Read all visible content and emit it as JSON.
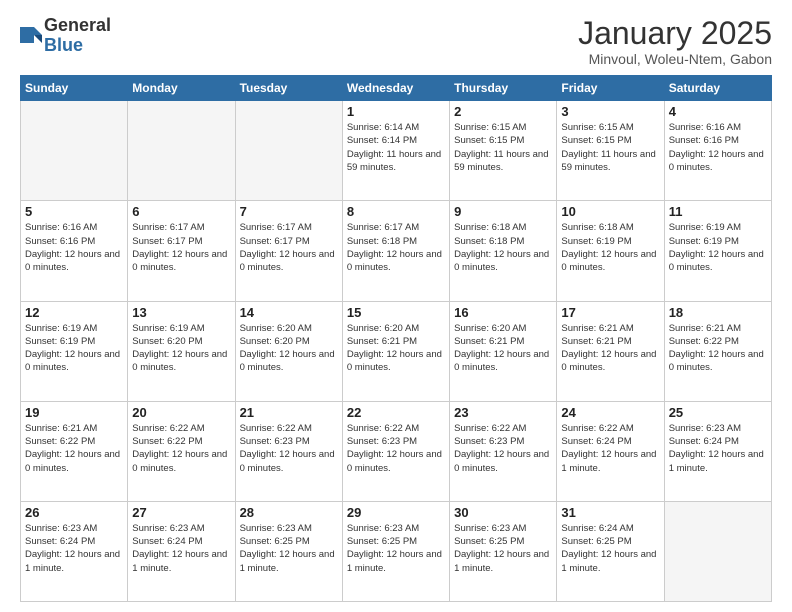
{
  "header": {
    "logo_general": "General",
    "logo_blue": "Blue",
    "month_title": "January 2025",
    "subtitle": "Minvoul, Woleu-Ntem, Gabon"
  },
  "days_of_week": [
    "Sunday",
    "Monday",
    "Tuesday",
    "Wednesday",
    "Thursday",
    "Friday",
    "Saturday"
  ],
  "weeks": [
    [
      {
        "day": "",
        "sunrise": "",
        "sunset": "",
        "daylight": ""
      },
      {
        "day": "",
        "sunrise": "",
        "sunset": "",
        "daylight": ""
      },
      {
        "day": "",
        "sunrise": "",
        "sunset": "",
        "daylight": ""
      },
      {
        "day": "1",
        "sunrise": "Sunrise: 6:14 AM",
        "sunset": "Sunset: 6:14 PM",
        "daylight": "Daylight: 11 hours and 59 minutes."
      },
      {
        "day": "2",
        "sunrise": "Sunrise: 6:15 AM",
        "sunset": "Sunset: 6:15 PM",
        "daylight": "Daylight: 11 hours and 59 minutes."
      },
      {
        "day": "3",
        "sunrise": "Sunrise: 6:15 AM",
        "sunset": "Sunset: 6:15 PM",
        "daylight": "Daylight: 11 hours and 59 minutes."
      },
      {
        "day": "4",
        "sunrise": "Sunrise: 6:16 AM",
        "sunset": "Sunset: 6:16 PM",
        "daylight": "Daylight: 12 hours and 0 minutes."
      }
    ],
    [
      {
        "day": "5",
        "sunrise": "Sunrise: 6:16 AM",
        "sunset": "Sunset: 6:16 PM",
        "daylight": "Daylight: 12 hours and 0 minutes."
      },
      {
        "day": "6",
        "sunrise": "Sunrise: 6:17 AM",
        "sunset": "Sunset: 6:17 PM",
        "daylight": "Daylight: 12 hours and 0 minutes."
      },
      {
        "day": "7",
        "sunrise": "Sunrise: 6:17 AM",
        "sunset": "Sunset: 6:17 PM",
        "daylight": "Daylight: 12 hours and 0 minutes."
      },
      {
        "day": "8",
        "sunrise": "Sunrise: 6:17 AM",
        "sunset": "Sunset: 6:18 PM",
        "daylight": "Daylight: 12 hours and 0 minutes."
      },
      {
        "day": "9",
        "sunrise": "Sunrise: 6:18 AM",
        "sunset": "Sunset: 6:18 PM",
        "daylight": "Daylight: 12 hours and 0 minutes."
      },
      {
        "day": "10",
        "sunrise": "Sunrise: 6:18 AM",
        "sunset": "Sunset: 6:19 PM",
        "daylight": "Daylight: 12 hours and 0 minutes."
      },
      {
        "day": "11",
        "sunrise": "Sunrise: 6:19 AM",
        "sunset": "Sunset: 6:19 PM",
        "daylight": "Daylight: 12 hours and 0 minutes."
      }
    ],
    [
      {
        "day": "12",
        "sunrise": "Sunrise: 6:19 AM",
        "sunset": "Sunset: 6:19 PM",
        "daylight": "Daylight: 12 hours and 0 minutes."
      },
      {
        "day": "13",
        "sunrise": "Sunrise: 6:19 AM",
        "sunset": "Sunset: 6:20 PM",
        "daylight": "Daylight: 12 hours and 0 minutes."
      },
      {
        "day": "14",
        "sunrise": "Sunrise: 6:20 AM",
        "sunset": "Sunset: 6:20 PM",
        "daylight": "Daylight: 12 hours and 0 minutes."
      },
      {
        "day": "15",
        "sunrise": "Sunrise: 6:20 AM",
        "sunset": "Sunset: 6:21 PM",
        "daylight": "Daylight: 12 hours and 0 minutes."
      },
      {
        "day": "16",
        "sunrise": "Sunrise: 6:20 AM",
        "sunset": "Sunset: 6:21 PM",
        "daylight": "Daylight: 12 hours and 0 minutes."
      },
      {
        "day": "17",
        "sunrise": "Sunrise: 6:21 AM",
        "sunset": "Sunset: 6:21 PM",
        "daylight": "Daylight: 12 hours and 0 minutes."
      },
      {
        "day": "18",
        "sunrise": "Sunrise: 6:21 AM",
        "sunset": "Sunset: 6:22 PM",
        "daylight": "Daylight: 12 hours and 0 minutes."
      }
    ],
    [
      {
        "day": "19",
        "sunrise": "Sunrise: 6:21 AM",
        "sunset": "Sunset: 6:22 PM",
        "daylight": "Daylight: 12 hours and 0 minutes."
      },
      {
        "day": "20",
        "sunrise": "Sunrise: 6:22 AM",
        "sunset": "Sunset: 6:22 PM",
        "daylight": "Daylight: 12 hours and 0 minutes."
      },
      {
        "day": "21",
        "sunrise": "Sunrise: 6:22 AM",
        "sunset": "Sunset: 6:23 PM",
        "daylight": "Daylight: 12 hours and 0 minutes."
      },
      {
        "day": "22",
        "sunrise": "Sunrise: 6:22 AM",
        "sunset": "Sunset: 6:23 PM",
        "daylight": "Daylight: 12 hours and 0 minutes."
      },
      {
        "day": "23",
        "sunrise": "Sunrise: 6:22 AM",
        "sunset": "Sunset: 6:23 PM",
        "daylight": "Daylight: 12 hours and 0 minutes."
      },
      {
        "day": "24",
        "sunrise": "Sunrise: 6:22 AM",
        "sunset": "Sunset: 6:24 PM",
        "daylight": "Daylight: 12 hours and 1 minute."
      },
      {
        "day": "25",
        "sunrise": "Sunrise: 6:23 AM",
        "sunset": "Sunset: 6:24 PM",
        "daylight": "Daylight: 12 hours and 1 minute."
      }
    ],
    [
      {
        "day": "26",
        "sunrise": "Sunrise: 6:23 AM",
        "sunset": "Sunset: 6:24 PM",
        "daylight": "Daylight: 12 hours and 1 minute."
      },
      {
        "day": "27",
        "sunrise": "Sunrise: 6:23 AM",
        "sunset": "Sunset: 6:24 PM",
        "daylight": "Daylight: 12 hours and 1 minute."
      },
      {
        "day": "28",
        "sunrise": "Sunrise: 6:23 AM",
        "sunset": "Sunset: 6:25 PM",
        "daylight": "Daylight: 12 hours and 1 minute."
      },
      {
        "day": "29",
        "sunrise": "Sunrise: 6:23 AM",
        "sunset": "Sunset: 6:25 PM",
        "daylight": "Daylight: 12 hours and 1 minute."
      },
      {
        "day": "30",
        "sunrise": "Sunrise: 6:23 AM",
        "sunset": "Sunset: 6:25 PM",
        "daylight": "Daylight: 12 hours and 1 minute."
      },
      {
        "day": "31",
        "sunrise": "Sunrise: 6:24 AM",
        "sunset": "Sunset: 6:25 PM",
        "daylight": "Daylight: 12 hours and 1 minute."
      },
      {
        "day": "",
        "sunrise": "",
        "sunset": "",
        "daylight": ""
      }
    ]
  ]
}
